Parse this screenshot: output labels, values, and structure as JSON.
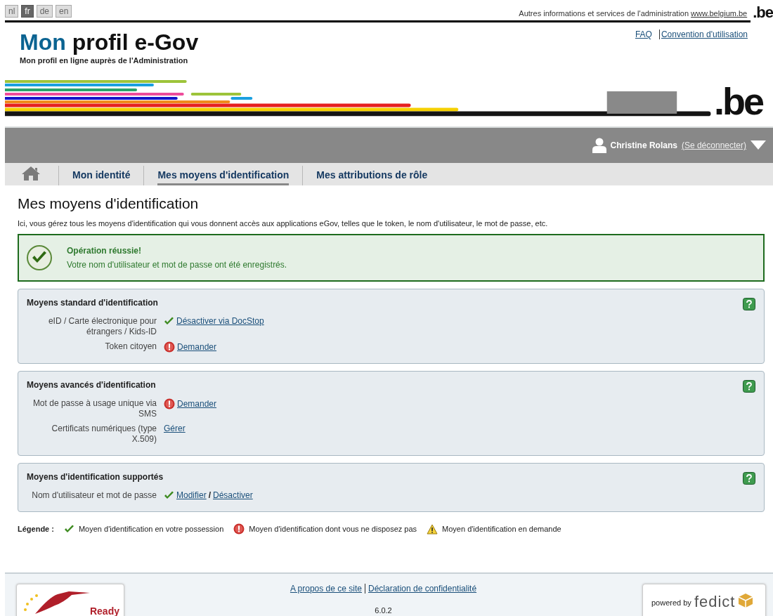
{
  "languages": [
    {
      "label": "nl",
      "selected": false
    },
    {
      "label": "fr",
      "selected": true
    },
    {
      "label": "de",
      "selected": false
    },
    {
      "label": "en",
      "selected": false
    }
  ],
  "top_bar": {
    "text": "Autres informations et services de l'administration",
    "link": "www.belgium.be",
    "logo": ".be"
  },
  "header": {
    "title_accent": "Mon",
    "title_rest": "profil e-Gov",
    "subtitle": "Mon profil en ligne auprès de l'Administration",
    "links": [
      "FAQ",
      "Convention d'utilisation"
    ],
    "logo": ".be"
  },
  "user": {
    "name": "Christine Rolans",
    "logout": "(Se déconnecter)"
  },
  "tabs": [
    {
      "kind": "home",
      "selected": false
    },
    {
      "kind": "text",
      "label": "Mon identité",
      "selected": false
    },
    {
      "kind": "text",
      "label": "Mes moyens d'identification",
      "selected": true
    },
    {
      "kind": "text",
      "label": "Mes attributions de rôle",
      "selected": false
    }
  ],
  "page_title": "Mes moyens d'identification",
  "intro": "Ici, vous gérez tous les moyens d'identification qui vous donnent accès aux applications eGov, telles que le token, le nom d'utilisateur, le mot de passe, etc.",
  "alert": {
    "title": "Opération réussie!",
    "message": "Votre nom d'utilisateur et mot de passe ont été enregistrés."
  },
  "sections": [
    {
      "title": "Moyens standard d'identification",
      "rows": [
        {
          "label": "eID / Carte électronique pour étrangers / Kids-ID",
          "kind": "owned",
          "actions": [
            {
              "kind": "link",
              "text": "Désactiver via DocStop"
            }
          ]
        },
        {
          "label": "Token citoyen",
          "kind": "missing",
          "actions": [
            {
              "kind": "link",
              "text": "Demander"
            }
          ]
        }
      ]
    },
    {
      "title": "Moyens avancés d'identification",
      "rows": [
        {
          "label": "Mot de passe à usage unique via SMS",
          "kind": "missing",
          "actions": [
            {
              "kind": "link",
              "text": "Demander"
            }
          ]
        },
        {
          "label": "Certificats numériques (type X.509)",
          "kind": "plain",
          "actions": [
            {
              "kind": "link",
              "text": "Gérer"
            }
          ]
        }
      ]
    },
    {
      "title": "Moyens d'identification supportés",
      "rows": [
        {
          "label": "Nom d'utilisateur et mot de passe",
          "kind": "owned",
          "actions": [
            {
              "kind": "link",
              "text": "Modifier"
            },
            {
              "kind": "separator",
              "text": "/"
            },
            {
              "kind": "link",
              "text": "Désactiver"
            }
          ]
        }
      ]
    }
  ],
  "legend": {
    "label": "Légende :",
    "items": [
      {
        "kind": "owned",
        "text": "Moyen d'identification en votre possession"
      },
      {
        "kind": "missing",
        "text": "Moyen d'identification dont vous ne disposez pas"
      },
      {
        "kind": "pending",
        "text": "Moyen d'identification en demande"
      }
    ]
  },
  "footer": {
    "links": [
      "A propos de ce site",
      "Déclaration de confidentialité"
    ],
    "version": "6.0.2",
    "badge": "Ready",
    "powered_by": "powered by",
    "partner": "fedict"
  }
}
